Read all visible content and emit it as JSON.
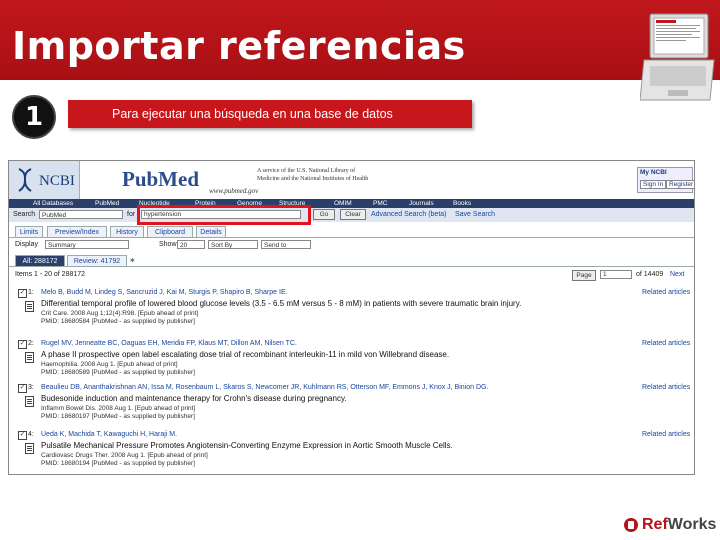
{
  "slide": {
    "title": "Importar referencias",
    "step_number": "1",
    "step_text": "Para ejecutar una búsqueda en una base de datos"
  },
  "pubmed": {
    "ncbi_label": "NCBI",
    "logo": "PubMed",
    "url": "www.pubmed.gov",
    "service_text": "A service of the U.S. National Library of Medicine and the National Institutes of Health",
    "myncbi": {
      "title": "My NCBI",
      "sign_in": "Sign In",
      "register": "Register"
    },
    "nav": [
      "All Databases",
      "PubMed",
      "Nucleotide",
      "Protein",
      "Genome",
      "Structure",
      "OMIM",
      "PMC",
      "Journals",
      "Books"
    ],
    "search": {
      "label": "Search",
      "database": "PubMed",
      "for_label": "for",
      "query": "hypertension",
      "go": "Go",
      "clear": "Clear",
      "advanced": "Advanced Search (beta)",
      "save": "Save Search"
    },
    "tabs": [
      "Limits",
      "Preview/Index",
      "History",
      "Clipboard",
      "Details"
    ],
    "display": {
      "label": "Display",
      "value": "Summary",
      "show_label": "Show",
      "show_value": "20",
      "sort": "Sort By",
      "send": "Send to"
    },
    "result_tabs": {
      "all": "All: 288172",
      "review": "Review: 41792"
    },
    "items_text": "Items 1 - 20 of 288172",
    "page_label": "Page",
    "page_value": "1",
    "page_of": "of 14409",
    "next": "Next",
    "results": [
      {
        "number": "1:",
        "authors": "Melo B, Budd M, Lindeg S, Sancruzid J, Kai M, Sturgis P, Shapiro B, Sharpe IE.",
        "title": "Differential temporal profile of lowered blood glucose levels (3.5 - 6.5 mM versus 5 - 8 mM) in patients with severe traumatic brain injury.",
        "journal": "Crit Care. 2008 Aug 1;12(4):R98. [Epub ahead of print]",
        "pmid": "PMID: 18680584 [PubMed - as supplied by publisher]",
        "related": "Related articles"
      },
      {
        "number": "2:",
        "authors": "Rugel MV, Jenneatte BC, Oaguas EH, Meridia FP, Klaus MT, Dillon AM, Nilsen TC.",
        "title": "A phase II prospective open label escalating dose trial of recombinant interleukin-11 in mild von Willebrand disease.",
        "journal": "Haemophilia. 2008 Aug 1. [Epub ahead of print]",
        "pmid": "PMID: 18680589 [PubMed - as supplied by publisher]",
        "related": "Related articles"
      },
      {
        "number": "3:",
        "authors": "Beaulieu DB, Ananthakrishnan AN, Issa M, Rosenbaum L, Skaros S, Newcomer JR, Kuhlmann RS, Otterson MF, Emmons J, Knox J, Binion DG.",
        "title": "Budesonide induction and maintenance therapy for Crohn's disease during pregnancy.",
        "journal": "Inflamm Bowel Dis. 2008 Aug 1. [Epub ahead of print]",
        "pmid": "PMID: 18680197 [PubMed - as supplied by publisher]",
        "related": "Related articles"
      },
      {
        "number": "4:",
        "authors": "Ueda K, Machida T, Kawaguchi H, Haraji M.",
        "title": "Pulsatile Mechanical Pressure Promotes Angiotensin-Converting Enzyme Expression in Aortic Smooth Muscle Cells.",
        "journal": "Cardiovasc Drugs Ther. 2008 Aug 1. [Epub ahead of print]",
        "pmid": "PMID: 18680194 [PubMed - as supplied by publisher]",
        "related": "Related articles"
      }
    ]
  },
  "brand": {
    "ref": "Ref",
    "works": "Works"
  },
  "colors": {
    "red": "#c0181c",
    "ncbi_blue": "#2b3f6b",
    "link": "#1a46a0"
  }
}
